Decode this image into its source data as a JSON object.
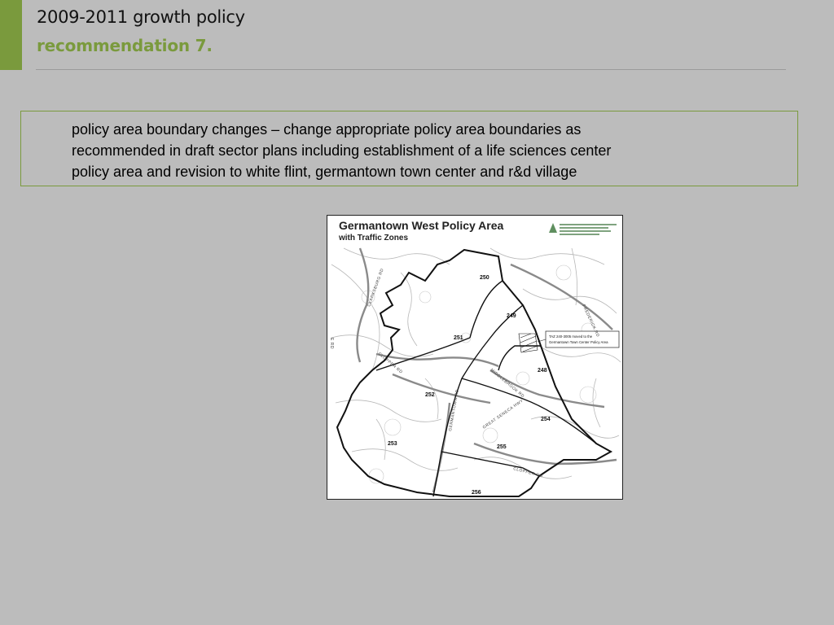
{
  "slide": {
    "title_line1": "2009-2011 growth policy",
    "title_line2": "recommendation 7.",
    "accent_color": "#7a9a3d",
    "body_text": "policy area boundary changes – change appropriate policy area boundaries as\nrecommended in draft sector plans including establishment of a life sciences center\npolicy area and revision to white flint, germantown town center and r&d village"
  },
  "map": {
    "title": "Germantown West Policy Area",
    "subtitle": "with Traffic Zones",
    "zones": [
      "250",
      "249",
      "251",
      "248",
      "252",
      "254",
      "253",
      "255",
      "256"
    ],
    "roads": [
      "CLARKSBURG RD",
      "FREDERICK RD",
      "CLOPPER RD",
      "GERMANTOWN RD",
      "GREAT SENECA HWY",
      "MIDDLEBROOK RD",
      "CLOPPER RD",
      "E RD"
    ],
    "callout_line1": "TAZ 240-3005 moved to the",
    "callout_line2": "Germantown Town Center Policy Area"
  }
}
